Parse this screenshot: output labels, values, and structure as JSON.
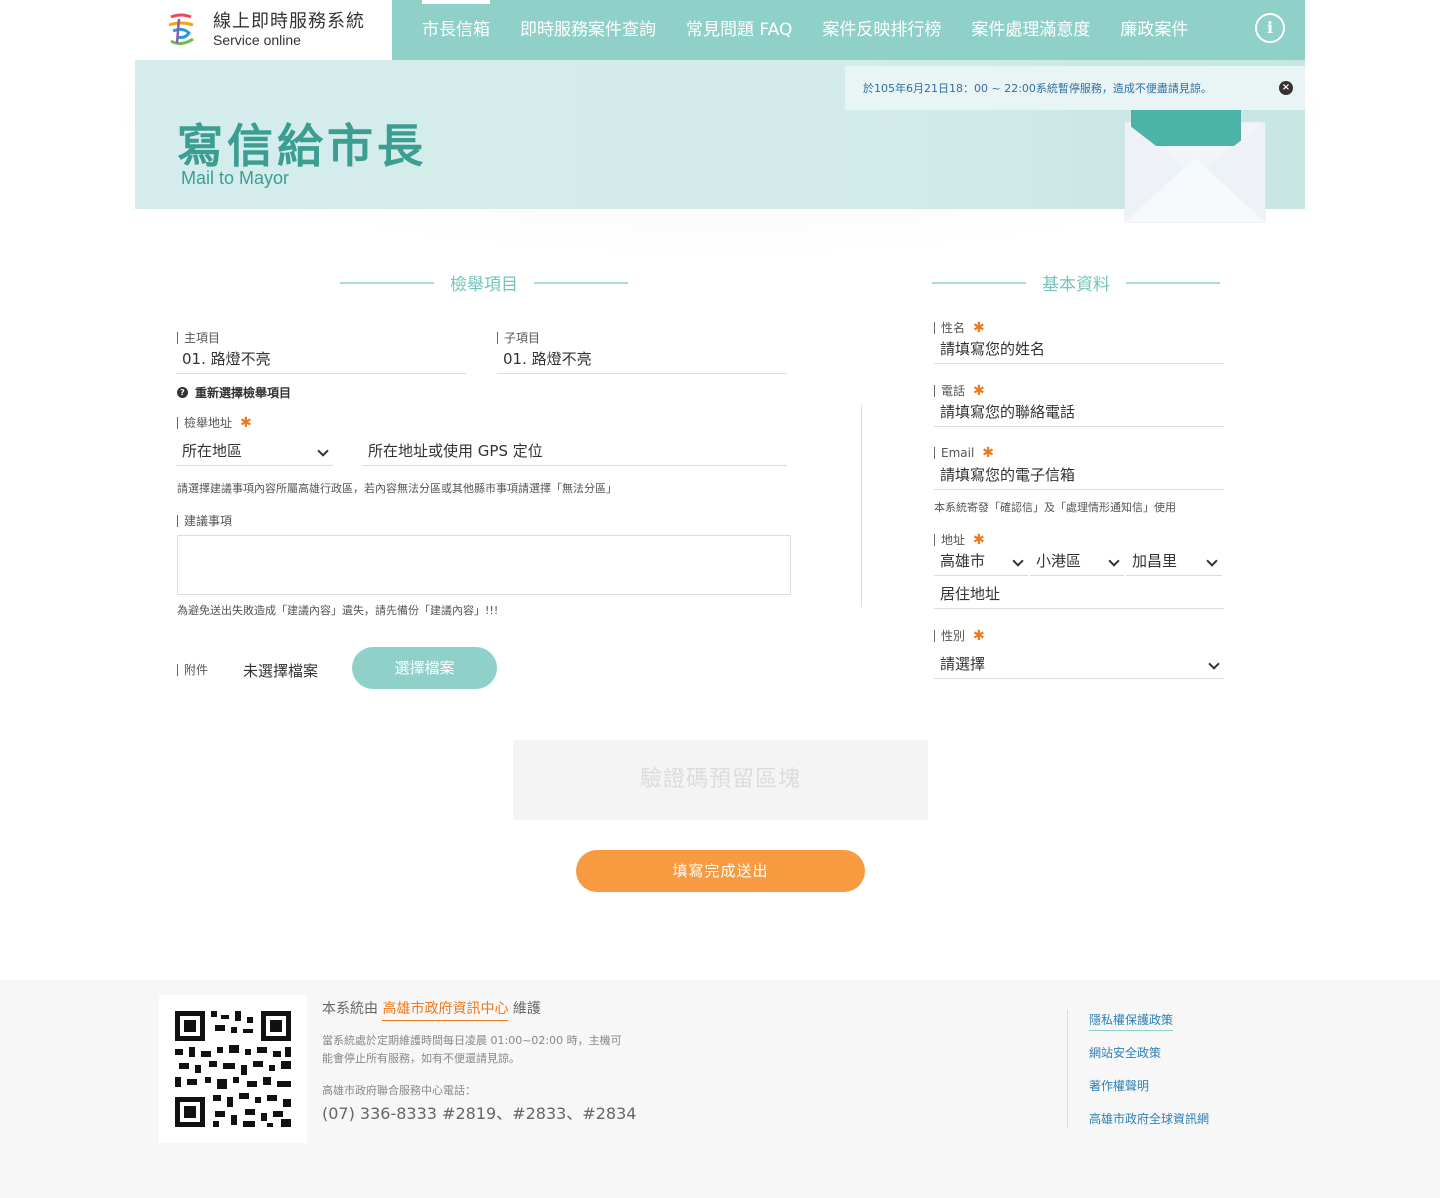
{
  "header": {
    "logo_zh": "線上即時服務系統",
    "logo_en": "Service online",
    "nav": [
      {
        "label": "市長信箱"
      },
      {
        "label": "即時服務案件查詢"
      },
      {
        "label": "常見問題 FAQ"
      },
      {
        "label": "案件反映排行榜"
      },
      {
        "label": "案件處理滿意度"
      },
      {
        "label": "廉政案件"
      }
    ],
    "info_glyph": "i"
  },
  "banner": {
    "title": "寫信給市長",
    "subtitle": "Mail to Mayor",
    "notice": "於105年6月21日18：00 ~ 22:00系統暫停服務，造成不便盡請見諒。",
    "close_glyph": "×"
  },
  "report": {
    "heading": "檢舉項目",
    "main_item_label": "主項目",
    "main_item_value": "01. 路燈不亮",
    "sub_item_label": "子項目",
    "sub_item_value": "01. 路燈不亮",
    "reselect": "重新選擇檢舉項目",
    "address_label": "檢舉地址",
    "district_select": "所在地區",
    "address_placeholder": "所在地址或使用 GPS 定位",
    "address_hint": "請選擇建議事項內容所屬高雄行政區，若內容無法分區或其他縣市事項請選擇「無法分區」",
    "suggestion_label": "建議事項",
    "suggestion_hint": "為避免送出失敗造成「建議內容」遺失，請先備份「建議內容」!!!",
    "attachment_label": "附件",
    "attachment_status": "未選擇檔案",
    "choose_file": "選擇檔案",
    "required_mark": "✱"
  },
  "basic": {
    "heading": "基本資料",
    "name_label": "性名",
    "name_placeholder": "請填寫您的姓名",
    "phone_label": "電話",
    "phone_placeholder": "請填寫您的聯絡電話",
    "email_label": "Email",
    "email_placeholder": "請填寫您的電子信箱",
    "email_hint": "本系統寄發「確認信」及「處理情形通知信」使用",
    "address_label": "地址",
    "city": "高雄市",
    "district": "小港區",
    "village": "加昌里",
    "address_placeholder": "居住地址",
    "gender_label": "性別",
    "gender_select": "請選擇"
  },
  "captcha": "驗證碼預留區塊",
  "submit": "填寫完成送出",
  "footer": {
    "maintain_prefix": "本系統由",
    "maintain_org": "高雄市政府資訊中心",
    "maintain_suffix": "維護",
    "note": "當系統處於定期維護時間每日凌晨 01:00~02:00 時，主機可能會停止所有服務，如有不便還請見諒。",
    "phone_label": "高雄市政府聯合服務中心電話：",
    "phone": "(07) 336-8333 #2819、#2833、#2834",
    "links": [
      {
        "label": "隱私權保護政策"
      },
      {
        "label": "網站安全政策"
      },
      {
        "label": "著作權聲明"
      },
      {
        "label": "高雄市政府全球資訊網"
      }
    ]
  },
  "colors": {
    "accent": "#8fd0c8",
    "title": "#3c9e93",
    "required": "#ef7a1e",
    "submit": "#f79a40",
    "link": "#2f80b5"
  }
}
